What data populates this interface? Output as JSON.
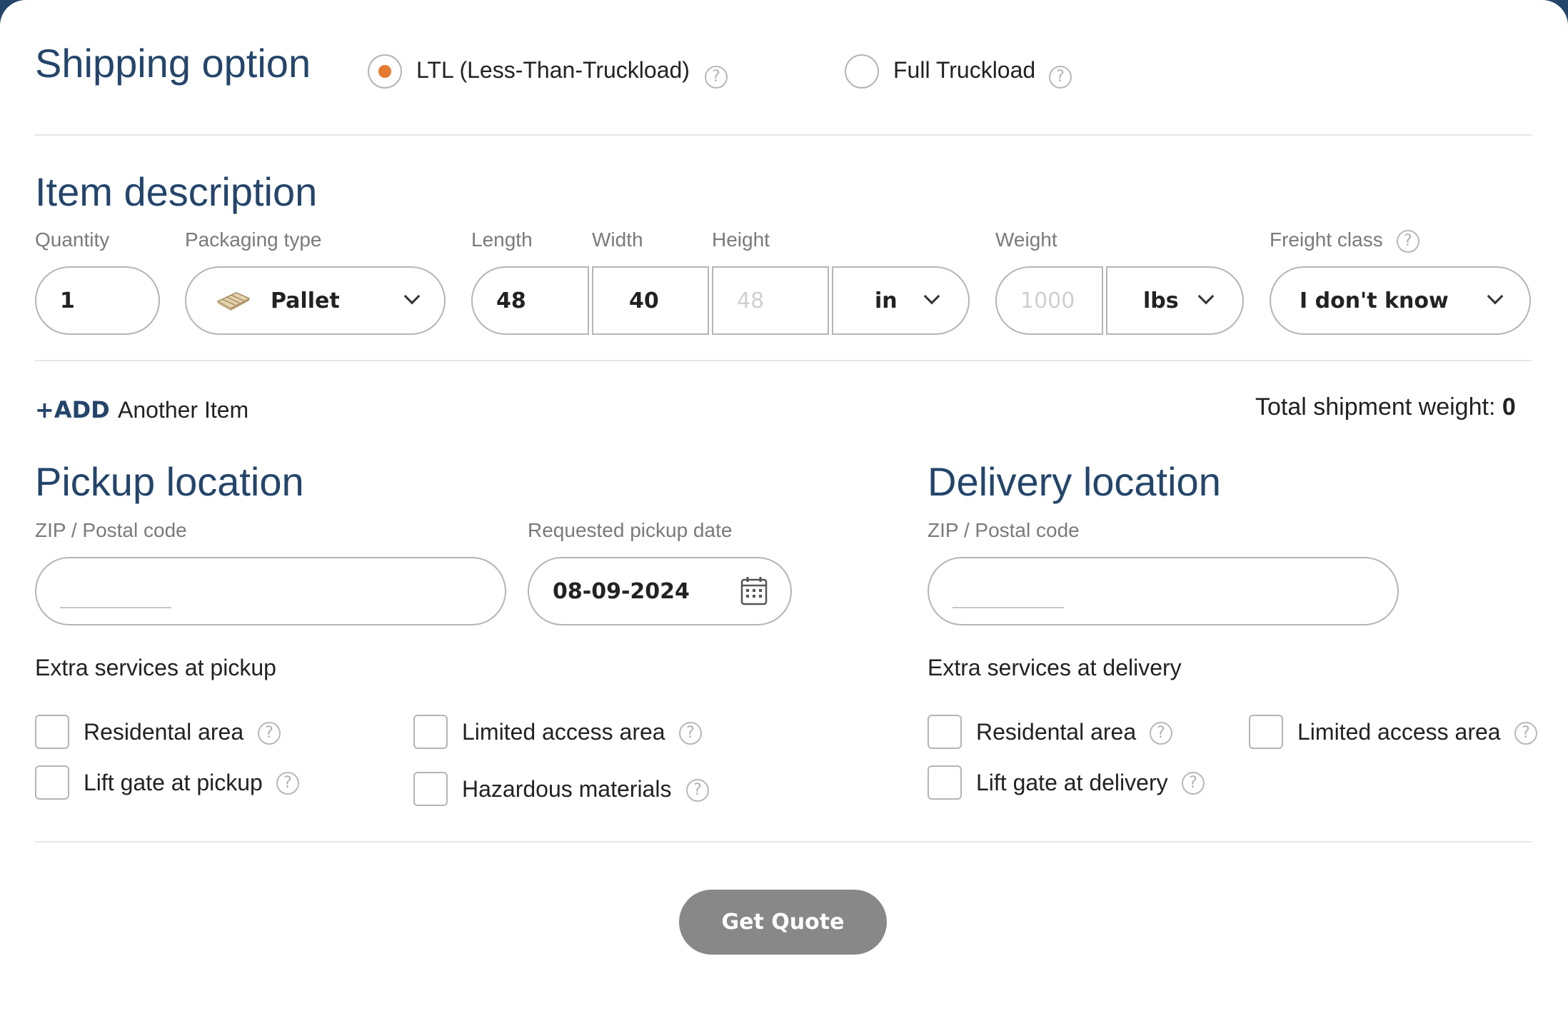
{
  "shipping": {
    "title": "Shipping option",
    "options": [
      {
        "label": "LTL (Less-Than-Truckload)",
        "selected": true
      },
      {
        "label": "Full Truckload",
        "selected": false
      }
    ]
  },
  "item": {
    "title": "Item description",
    "labels": {
      "quantity": "Quantity",
      "packaging": "Packaging type",
      "length": "Length",
      "width": "Width",
      "height": "Height",
      "weight": "Weight",
      "freight_class": "Freight class"
    },
    "quantity": "1",
    "packaging": "Pallet",
    "length": "48",
    "width": "40",
    "height_placeholder": "48",
    "dim_unit": "in",
    "weight_placeholder": "1000",
    "weight_unit": "lbs",
    "freight_class": "I don't know"
  },
  "add": {
    "label": "+ADD",
    "text": "Another Item"
  },
  "total": {
    "label": "Total shipment weight: ",
    "value": "0"
  },
  "pickup": {
    "title": "Pickup location",
    "zip_label": "ZIP / Postal code",
    "zip_value": "",
    "date_label": "Requested pickup date",
    "date_value": "08-09-2024",
    "extra_title": "Extra services at pickup",
    "services": [
      "Residental area",
      "Limited access area",
      "Lift gate at pickup",
      "Hazardous materials"
    ]
  },
  "delivery": {
    "title": "Delivery location",
    "zip_label": "ZIP / Postal code",
    "zip_value": "",
    "extra_title": "Extra services at delivery",
    "services": [
      "Residental area",
      "Limited access area",
      "Lift gate at delivery"
    ]
  },
  "submit": {
    "label": "Get Quote"
  },
  "help_glyph": "?",
  "icons": {
    "packaging": "pallet-icon",
    "date": "calendar-icon",
    "dropdown": "chevron-down-icon",
    "help": "question-icon"
  },
  "colors": {
    "heading": "#24456b",
    "radio_selected": "#e67a30",
    "button": "#888888",
    "frame": "#24456b"
  }
}
